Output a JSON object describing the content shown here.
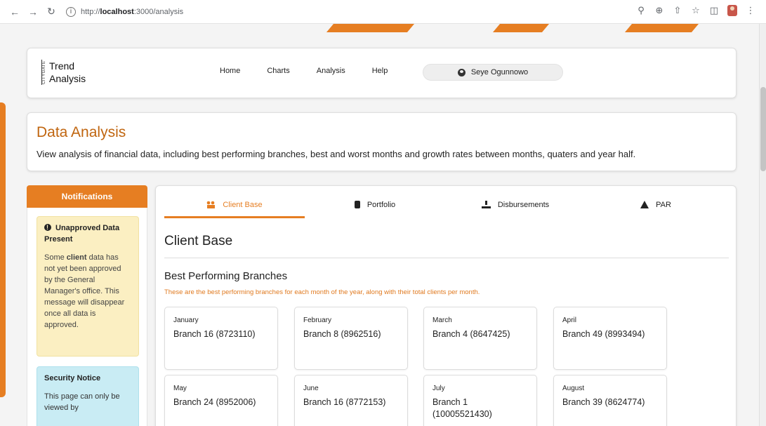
{
  "browser": {
    "url_prefix": "http://",
    "url_host": "localhost",
    "url_rest": ":3000/analysis"
  },
  "header": {
    "logo_tag": "CITYGATE",
    "logo_line1": "Trend",
    "logo_line2": "Analysis",
    "nav": [
      "Home",
      "Charts",
      "Analysis",
      "Help"
    ],
    "user": "Seye Ogunnowo"
  },
  "page": {
    "title": "Data Analysis",
    "description": "View analysis of financial data, including best performing branches, best and worst months and growth rates between months, quaters and year half."
  },
  "notifications": {
    "heading": "Notifications",
    "warning": {
      "title": "Unapproved Data Present",
      "text_before": "Some ",
      "text_bold": "client",
      "text_after": " data has not yet been approved by the General Manager's office. This message will disappear once all data is approved."
    },
    "security": {
      "title": "Security Notice",
      "text": "This page can only be viewed by"
    }
  },
  "tabs": [
    {
      "label": "Client Base",
      "icon": "users-icon",
      "active": true
    },
    {
      "label": "Portfolio",
      "icon": "briefcase-icon",
      "active": false
    },
    {
      "label": "Disbursements",
      "icon": "hand-money-icon",
      "active": false
    },
    {
      "label": "PAR",
      "icon": "warning-triangle-icon",
      "active": false
    }
  ],
  "client_base": {
    "title": "Client Base",
    "best_title": "Best Performing Branches",
    "best_desc": "These are the best performing branches for each month of the year, along with their total clients per month.",
    "branches": [
      {
        "month": "January",
        "value": "Branch 16 (8723110)"
      },
      {
        "month": "February",
        "value": "Branch 8 (8962516)"
      },
      {
        "month": "March",
        "value": "Branch 4 (8647425)"
      },
      {
        "month": "April",
        "value": "Branch 49 (8993494)"
      },
      {
        "month": "May",
        "value": "Branch 24 (8952006)"
      },
      {
        "month": "June",
        "value": "Branch 16 (8772153)"
      },
      {
        "month": "July",
        "value": "Branch 1 (10005521430)"
      },
      {
        "month": "August",
        "value": "Branch 39 (8624774)"
      }
    ]
  },
  "colors": {
    "accent": "#e67e22",
    "title": "#c0650f",
    "warning_bg": "#fbefc2",
    "info_bg": "#c9ecf4"
  }
}
